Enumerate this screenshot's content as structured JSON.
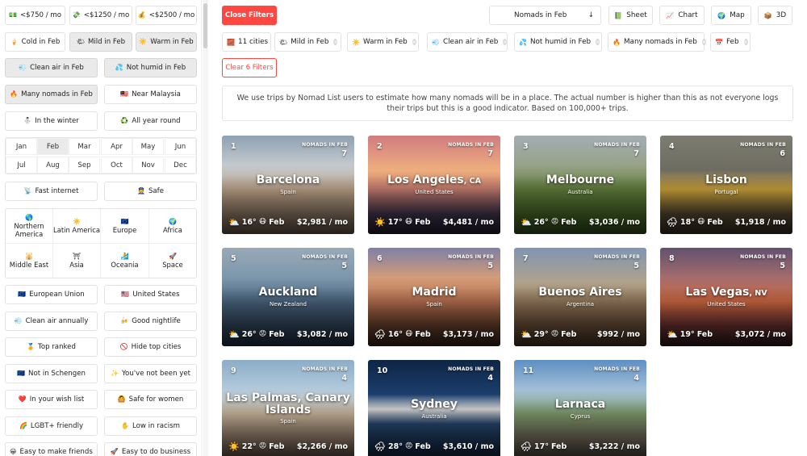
{
  "sidebar": {
    "cost_filters": [
      {
        "icon": "💵",
        "label": "<$750 / mo"
      },
      {
        "icon": "💸",
        "label": "<$1250 / mo"
      },
      {
        "icon": "💰",
        "label": "<$2500 / mo"
      }
    ],
    "weather_filters": [
      {
        "icon": "🍦",
        "label": "Cold in Feb"
      },
      {
        "icon": "🌤",
        "label": "Mild in Feb"
      },
      {
        "icon": "☀️",
        "label": "Warm in Feb"
      }
    ],
    "clean_air": {
      "icon": "💨",
      "label": "Clean air in Feb"
    },
    "not_humid": {
      "icon": "💦",
      "label": "Not humid in Feb"
    },
    "many_nomads": {
      "icon": "🔥",
      "label": "Many nomads in Feb"
    },
    "near": {
      "icon": "🇲🇾",
      "label": "Near Malaysia"
    },
    "in_winter": {
      "icon": "⛄",
      "label": "In the winter"
    },
    "all_year": {
      "icon": "♻️",
      "label": "All year round"
    },
    "months": [
      "Jan",
      "Feb",
      "Mar",
      "Apr",
      "May",
      "Jun",
      "Jul",
      "Aug",
      "Sep",
      "Oct",
      "Nov",
      "Dec"
    ],
    "fast_internet": {
      "icon": "📡",
      "label": "Fast internet"
    },
    "safe": {
      "icon": "👮",
      "label": "Safe"
    },
    "regions": [
      {
        "icon": "🌎",
        "label": "Northern America"
      },
      {
        "icon": "☀️",
        "label": "Latin America"
      },
      {
        "icon": "🇪🇺",
        "label": "Europe"
      },
      {
        "icon": "🌍",
        "label": "Africa"
      },
      {
        "icon": "🕌",
        "label": "Middle East"
      },
      {
        "icon": "⛩",
        "label": "Asia"
      },
      {
        "icon": "🏄",
        "label": "Oceania"
      },
      {
        "icon": "🚀",
        "label": "Space"
      }
    ],
    "european_union": {
      "icon": "🇪🇺",
      "label": "European Union"
    },
    "united_states": {
      "icon": "🇺🇸",
      "label": "United States"
    },
    "clean_air_annually": {
      "icon": "💨",
      "label": "Clean air annually"
    },
    "good_nightlife": {
      "icon": "🍻",
      "label": "Good nightlife"
    },
    "top_ranked": {
      "icon": "🏅",
      "label": "Top ranked"
    },
    "hide_top": {
      "icon": "🚫",
      "label": "Hide top cities"
    },
    "not_schengen": {
      "icon": "🇪🇺",
      "label": "Not in Schengen"
    },
    "not_been": {
      "icon": "✨",
      "label": "You've not been yet"
    },
    "wish_list": {
      "icon": "❤️",
      "label": "In your wish list"
    },
    "safe_women": {
      "icon": "🙆",
      "label": "Safe for women"
    },
    "lgbt": {
      "icon": "🌈",
      "label": "LGBT+ friendly"
    },
    "low_racism": {
      "icon": "✋",
      "label": "Low in racism"
    },
    "make_friends": {
      "icon": "😀",
      "label": "Easy to make friends"
    },
    "do_business": {
      "icon": "🚀",
      "label": "Easy to do business"
    }
  },
  "toolbar": {
    "close_filters": "Close Filters",
    "sort_label": "Nomads in Feb",
    "sort_arrow": "↓",
    "sheet": {
      "icon": "📗",
      "label": "Sheet"
    },
    "chart": {
      "icon": "📈",
      "label": "Chart"
    },
    "map": {
      "icon": "🌍",
      "label": "Map"
    },
    "three_d": {
      "icon": "📦",
      "label": "3D"
    }
  },
  "active_filters": [
    {
      "icon": "🧱",
      "label": "11 cities",
      "removable": false
    },
    {
      "icon": "🌤",
      "label": "Mild in Feb",
      "removable": true
    },
    {
      "icon": "☀️",
      "label": "Warm in Feb",
      "removable": true
    },
    {
      "icon": "💨",
      "label": "Clean air in Feb",
      "removable": true
    },
    {
      "icon": "💦",
      "label": "Not humid in Feb",
      "removable": true
    },
    {
      "icon": "🔥",
      "label": "Many nomads in Feb",
      "removable": true
    },
    {
      "icon": "📅",
      "label": "Feb",
      "removable": true
    }
  ],
  "clear_filters": "Clear 6 Filters",
  "info_text": "We use trips by Nomad List users to estimate how many nomads will be in a place. The actual number is higher than this as not everyone logs their trips but this is a good indicator. Based on 100,000+ trips.",
  "nomads_label": "NOMADS IN FEB",
  "cities": [
    {
      "rank": "1",
      "nomads": "7",
      "name": "Barcelona",
      "state": "",
      "country": "Spain",
      "weather": "⛅",
      "temp": "16°",
      "aqi": "😷",
      "month": "Feb",
      "cost": "$2,981 / mo",
      "img": "img-barcelona"
    },
    {
      "rank": "2",
      "nomads": "7",
      "name": "Los Angeles",
      "state": "CA",
      "country": "United States",
      "weather": "☀️",
      "temp": "17°",
      "aqi": "😷",
      "month": "Feb",
      "cost": "$4,481 / mo",
      "img": "img-la"
    },
    {
      "rank": "3",
      "nomads": "7",
      "name": "Melbourne",
      "state": "",
      "country": "Australia",
      "weather": "⛅",
      "temp": "26°",
      "aqi": "😡",
      "month": "Feb",
      "cost": "$3,036 / mo",
      "img": "img-melbourne"
    },
    {
      "rank": "4",
      "nomads": "6",
      "name": "Lisbon",
      "state": "",
      "country": "Portugal",
      "weather": "🌧",
      "temp": "18°",
      "aqi": "😷",
      "month": "Feb",
      "cost": "$1,918 / mo",
      "img": "img-lisbon"
    },
    {
      "rank": "5",
      "nomads": "5",
      "name": "Auckland",
      "state": "",
      "country": "New Zealand",
      "weather": "⛅",
      "temp": "26°",
      "aqi": "😡",
      "month": "Feb",
      "cost": "$3,082 / mo",
      "img": "img-auckland"
    },
    {
      "rank": "6",
      "nomads": "5",
      "name": "Madrid",
      "state": "",
      "country": "Spain",
      "weather": "🌧",
      "temp": "16°",
      "aqi": "😷",
      "month": "Feb",
      "cost": "$3,173 / mo",
      "img": "img-madrid"
    },
    {
      "rank": "7",
      "nomads": "5",
      "name": "Buenos Aires",
      "state": "",
      "country": "Argentina",
      "weather": "⛅",
      "temp": "29°",
      "aqi": "😡",
      "month": "Feb",
      "cost": "$992 / mo",
      "img": "img-buenosaires"
    },
    {
      "rank": "8",
      "nomads": "5",
      "name": "Las Vegas",
      "state": "NV",
      "country": "United States",
      "weather": "⛅",
      "temp": "19°",
      "aqi": "",
      "month": "Feb",
      "cost": "$3,072 / mo",
      "img": "img-lasvegas"
    },
    {
      "rank": "9",
      "nomads": "4",
      "name": "Las Palmas, Canary Islands",
      "state": "",
      "country": "Spain",
      "weather": "☀️",
      "temp": "22°",
      "aqi": "😡",
      "month": "Feb",
      "cost": "$2,266 / mo",
      "img": "img-laspalmas"
    },
    {
      "rank": "10",
      "nomads": "4",
      "name": "Sydney",
      "state": "",
      "country": "Australia",
      "weather": "🌧",
      "temp": "28°",
      "aqi": "😡",
      "month": "Feb",
      "cost": "$3,610 / mo",
      "img": "img-sydney"
    },
    {
      "rank": "11",
      "nomads": "4",
      "name": "Larnaca",
      "state": "",
      "country": "Cyprus",
      "weather": "🌧",
      "temp": "17°",
      "aqi": "",
      "month": "Feb",
      "cost": "$3,222 / mo",
      "img": "img-larnaca"
    }
  ],
  "colors": {
    "accent": "#ff4742",
    "active_filter_bg": "#eaeaea"
  }
}
